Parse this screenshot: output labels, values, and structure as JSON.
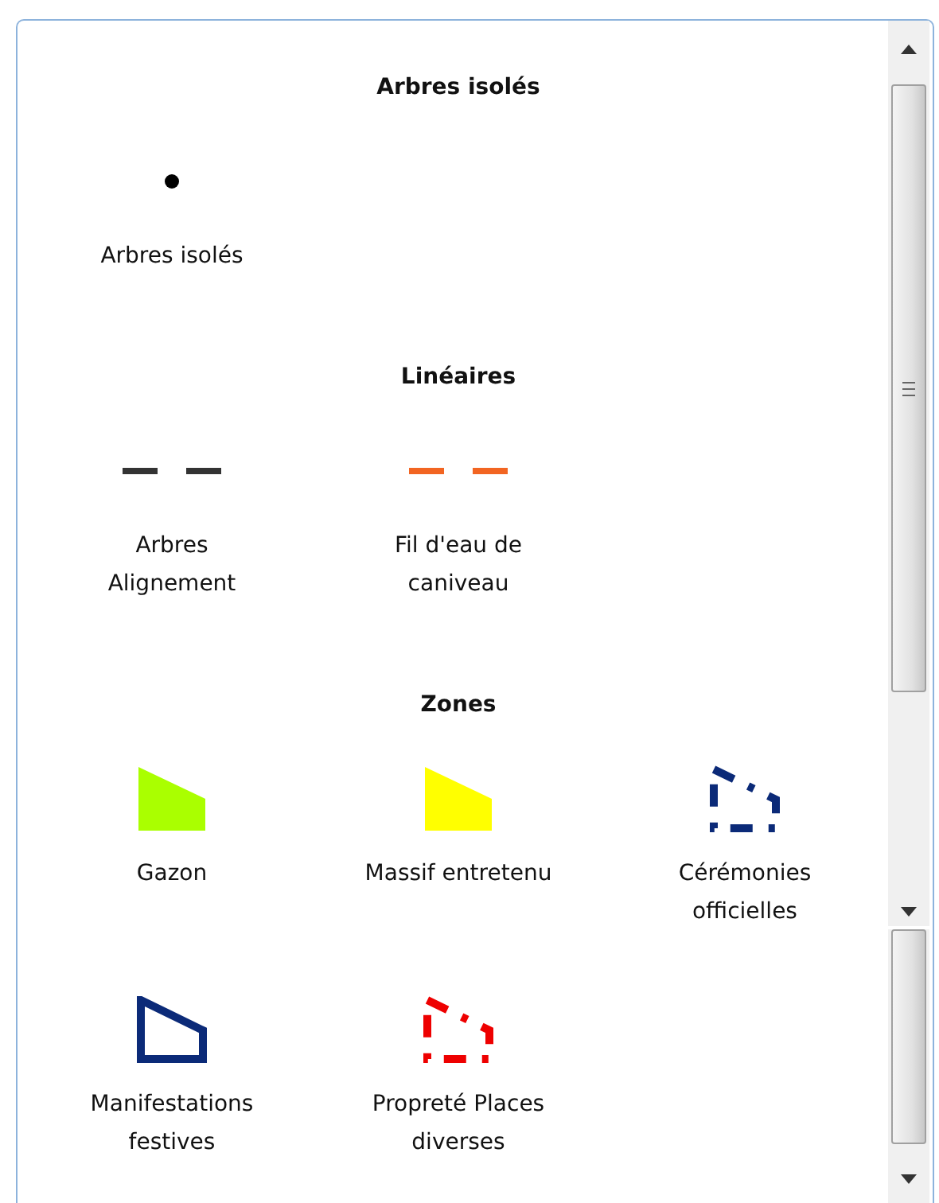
{
  "legend": {
    "sections": [
      {
        "title": "Arbres isolés",
        "items": [
          {
            "label": "Arbres isolés",
            "kind": "dot",
            "color": "#000000"
          }
        ]
      },
      {
        "title": "Linéaires",
        "items": [
          {
            "label": "Arbres\nAlignement",
            "kind": "dash",
            "color": "#333333"
          },
          {
            "label": "Fil d'eau de\ncaniveau",
            "kind": "dash",
            "color": "#f26522"
          }
        ]
      },
      {
        "title": "Zones",
        "items": [
          {
            "label": "Gazon",
            "kind": "fill",
            "color": "#aaff00"
          },
          {
            "label": "Massif entretenu",
            "kind": "fill",
            "color": "#ffff00"
          },
          {
            "label": "Cérémonies\nofficielles",
            "kind": "dashed-outline",
            "color": "#0b2a78"
          },
          {
            "label": "Manifestations\nfestives",
            "kind": "outline",
            "color": "#0b2a78"
          },
          {
            "label": "Propreté Places\ndiverses",
            "kind": "dashed-outline",
            "color": "#ee0000"
          }
        ]
      }
    ]
  }
}
